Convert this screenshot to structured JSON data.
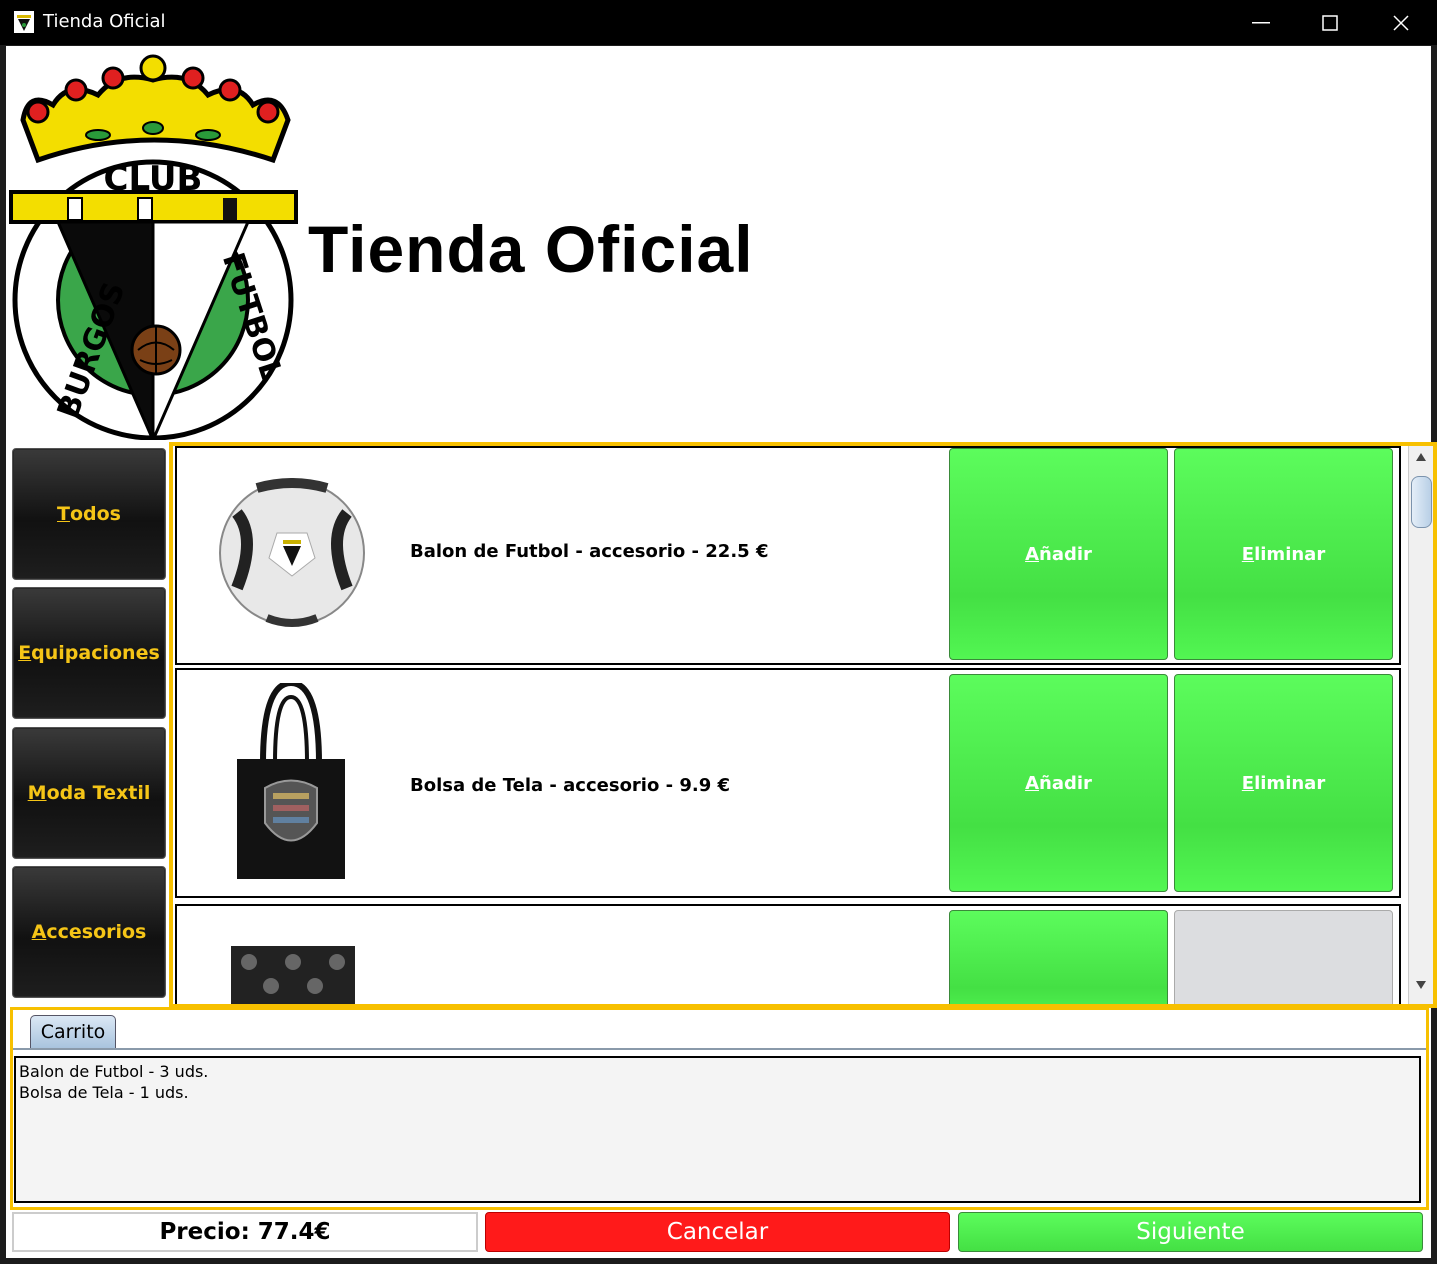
{
  "window": {
    "title": "Tienda Oficial"
  },
  "header": {
    "title": "Tienda Oficial",
    "logo_alt": "Burgos Club Futbol crest",
    "logo_text_club": "CLUB",
    "logo_text_left": "BURGOS",
    "logo_text_right": "FUTBOL"
  },
  "categories": [
    {
      "first": "T",
      "rest": "odos"
    },
    {
      "first": "E",
      "rest": "quipaciones"
    },
    {
      "first": "M",
      "rest": "oda Textil"
    },
    {
      "first": "A",
      "rest": "ccesorios"
    }
  ],
  "products": [
    {
      "name": "Balon de Futbol - accesorio - 22.5 €",
      "image": "ball-image"
    },
    {
      "name": "Bolsa de Tela - accesorio - 9.9 €",
      "image": "bag-image"
    },
    {
      "name": "",
      "image": "scarf-image"
    }
  ],
  "buttons": {
    "add_first": "A",
    "add_rest": "ñadir",
    "remove_first": "E",
    "remove_rest": "liminar",
    "cancel": "Cancelar",
    "next": "Siguiente"
  },
  "cart": {
    "tab_label": "Carrito",
    "lines": [
      "Balon de Futbol - 3 uds.",
      "Bolsa de Tela - 1 uds."
    ]
  },
  "price": "Precio: 77.4€",
  "colors": {
    "accent": "#f7c000",
    "green": "#4cee4c",
    "red": "#ff1a1a"
  }
}
